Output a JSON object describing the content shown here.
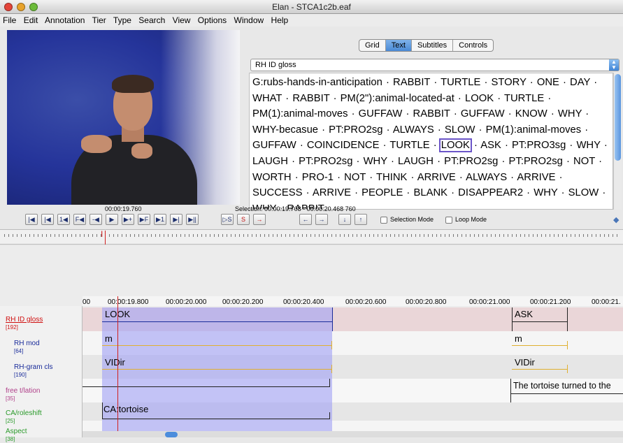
{
  "window": {
    "title": "Elan - STCA1c2b.eaf"
  },
  "menu": [
    "File",
    "Edit",
    "Annotation",
    "Tier",
    "Type",
    "Search",
    "View",
    "Options",
    "Window",
    "Help"
  ],
  "tabs": [
    {
      "label": "Grid",
      "active": false
    },
    {
      "label": "Text",
      "active": true
    },
    {
      "label": "Subtitles",
      "active": false
    },
    {
      "label": "Controls",
      "active": false
    }
  ],
  "tier_select": {
    "value": "RH ID gloss"
  },
  "gloss_text": {
    "before": "G:rubs-hands-in-anticipation · RABBIT · TURTLE · STORY · ONE · DAY · WHAT · RABBIT · PM(2\"):animal-located-at · LOOK · TURTLE · PM(1):animal-moves · GUFFAW · RABBIT · GUFFAW · KNOW · WHY · WHY-becasue · PT:PRO2sg · ALWAYS · SLOW · PM(1):animal-moves · GUFFAW · COINCIDENCE · TURTLE · ",
    "highlight": "LOOK",
    "after": " · ASK · PT:PRO3sg · WHY · LAUGH · PT:PRO2sg · WHY · LAUGH · PT:PRO2sg · PT:PRO2sg · NOT · WORTH · PRO-1 · NOT · THINK · ARRIVE · ALWAYS · ARRIVE · SUCCESS · ARRIVE · PEOPLE · BLANK · DISAPPEAR2 · WHY · SLOW · WHY · RABBIT"
  },
  "media": {
    "current_time": "00:00:19.760",
    "selection": "Selection: 00:00:19.708 - 00:00:20.468  760"
  },
  "controls": {
    "buttons": [
      "|◀",
      "|◀",
      "1◀",
      "F◀",
      "-◀",
      "▶",
      "▶+",
      "▶F",
      "▶1",
      "▶|",
      "▶||",
      "▷S",
      "S",
      "→",
      "←",
      "→",
      "↓",
      "↑"
    ],
    "selection_mode_label": "Selection Mode",
    "loop_mode_label": "Loop Mode"
  },
  "ruler_labels": [
    "00",
    "00:00:19.800",
    "00:00:20.000",
    "00:00:20.200",
    "00:00:20.400",
    "00:00:20.600",
    "00:00:20.800",
    "00:00:21.000",
    "00:00:21.200",
    "00:00:21."
  ],
  "tiers": [
    {
      "name": "RH ID gloss",
      "count": "[192]",
      "color": "#d01010"
    },
    {
      "name": "RH mod",
      "count": "[64]",
      "color": "#1a2c9a"
    },
    {
      "name": "RH-gram cls",
      "count": "[190]",
      "color": "#1a2c9a"
    },
    {
      "name": "free t/lation",
      "count": "[35]",
      "color": "#b0408a"
    },
    {
      "name": "CA/roleshift",
      "count": "[25]",
      "color": "#2a9a2a"
    },
    {
      "name": "Aspect",
      "count": "[38]",
      "color": "#2a9a2a"
    }
  ],
  "annotations": {
    "gloss_1": "LOOK",
    "gloss_2": "ASK",
    "mod_1": "m",
    "mod_2": "m",
    "gram_1": "VIDir",
    "gram_2": "VIDir",
    "free_1": "The tortoise turned to the",
    "ca_1": "CA:tortoise"
  }
}
